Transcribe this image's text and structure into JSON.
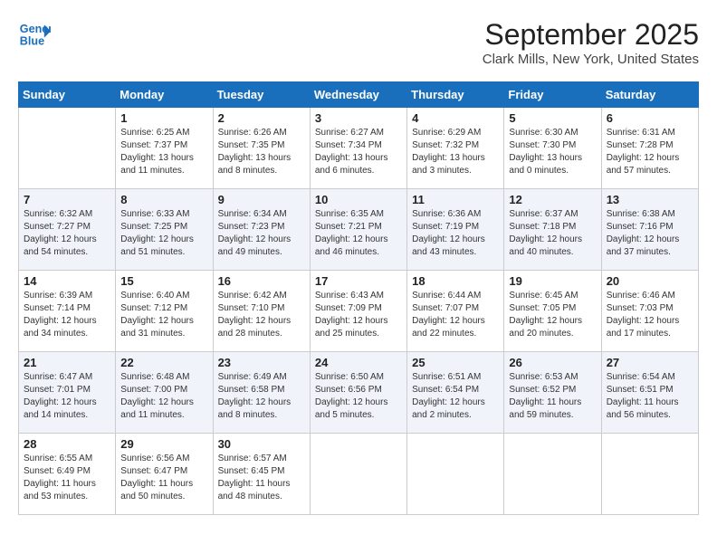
{
  "header": {
    "logo_line1": "General",
    "logo_line2": "Blue",
    "month": "September 2025",
    "location": "Clark Mills, New York, United States"
  },
  "weekdays": [
    "Sunday",
    "Monday",
    "Tuesday",
    "Wednesday",
    "Thursday",
    "Friday",
    "Saturday"
  ],
  "weeks": [
    [
      {
        "day": "",
        "info": ""
      },
      {
        "day": "1",
        "info": "Sunrise: 6:25 AM\nSunset: 7:37 PM\nDaylight: 13 hours\nand 11 minutes."
      },
      {
        "day": "2",
        "info": "Sunrise: 6:26 AM\nSunset: 7:35 PM\nDaylight: 13 hours\nand 8 minutes."
      },
      {
        "day": "3",
        "info": "Sunrise: 6:27 AM\nSunset: 7:34 PM\nDaylight: 13 hours\nand 6 minutes."
      },
      {
        "day": "4",
        "info": "Sunrise: 6:29 AM\nSunset: 7:32 PM\nDaylight: 13 hours\nand 3 minutes."
      },
      {
        "day": "5",
        "info": "Sunrise: 6:30 AM\nSunset: 7:30 PM\nDaylight: 13 hours\nand 0 minutes."
      },
      {
        "day": "6",
        "info": "Sunrise: 6:31 AM\nSunset: 7:28 PM\nDaylight: 12 hours\nand 57 minutes."
      }
    ],
    [
      {
        "day": "7",
        "info": "Sunrise: 6:32 AM\nSunset: 7:27 PM\nDaylight: 12 hours\nand 54 minutes."
      },
      {
        "day": "8",
        "info": "Sunrise: 6:33 AM\nSunset: 7:25 PM\nDaylight: 12 hours\nand 51 minutes."
      },
      {
        "day": "9",
        "info": "Sunrise: 6:34 AM\nSunset: 7:23 PM\nDaylight: 12 hours\nand 49 minutes."
      },
      {
        "day": "10",
        "info": "Sunrise: 6:35 AM\nSunset: 7:21 PM\nDaylight: 12 hours\nand 46 minutes."
      },
      {
        "day": "11",
        "info": "Sunrise: 6:36 AM\nSunset: 7:19 PM\nDaylight: 12 hours\nand 43 minutes."
      },
      {
        "day": "12",
        "info": "Sunrise: 6:37 AM\nSunset: 7:18 PM\nDaylight: 12 hours\nand 40 minutes."
      },
      {
        "day": "13",
        "info": "Sunrise: 6:38 AM\nSunset: 7:16 PM\nDaylight: 12 hours\nand 37 minutes."
      }
    ],
    [
      {
        "day": "14",
        "info": "Sunrise: 6:39 AM\nSunset: 7:14 PM\nDaylight: 12 hours\nand 34 minutes."
      },
      {
        "day": "15",
        "info": "Sunrise: 6:40 AM\nSunset: 7:12 PM\nDaylight: 12 hours\nand 31 minutes."
      },
      {
        "day": "16",
        "info": "Sunrise: 6:42 AM\nSunset: 7:10 PM\nDaylight: 12 hours\nand 28 minutes."
      },
      {
        "day": "17",
        "info": "Sunrise: 6:43 AM\nSunset: 7:09 PM\nDaylight: 12 hours\nand 25 minutes."
      },
      {
        "day": "18",
        "info": "Sunrise: 6:44 AM\nSunset: 7:07 PM\nDaylight: 12 hours\nand 22 minutes."
      },
      {
        "day": "19",
        "info": "Sunrise: 6:45 AM\nSunset: 7:05 PM\nDaylight: 12 hours\nand 20 minutes."
      },
      {
        "day": "20",
        "info": "Sunrise: 6:46 AM\nSunset: 7:03 PM\nDaylight: 12 hours\nand 17 minutes."
      }
    ],
    [
      {
        "day": "21",
        "info": "Sunrise: 6:47 AM\nSunset: 7:01 PM\nDaylight: 12 hours\nand 14 minutes."
      },
      {
        "day": "22",
        "info": "Sunrise: 6:48 AM\nSunset: 7:00 PM\nDaylight: 12 hours\nand 11 minutes."
      },
      {
        "day": "23",
        "info": "Sunrise: 6:49 AM\nSunset: 6:58 PM\nDaylight: 12 hours\nand 8 minutes."
      },
      {
        "day": "24",
        "info": "Sunrise: 6:50 AM\nSunset: 6:56 PM\nDaylight: 12 hours\nand 5 minutes."
      },
      {
        "day": "25",
        "info": "Sunrise: 6:51 AM\nSunset: 6:54 PM\nDaylight: 12 hours\nand 2 minutes."
      },
      {
        "day": "26",
        "info": "Sunrise: 6:53 AM\nSunset: 6:52 PM\nDaylight: 11 hours\nand 59 minutes."
      },
      {
        "day": "27",
        "info": "Sunrise: 6:54 AM\nSunset: 6:51 PM\nDaylight: 11 hours\nand 56 minutes."
      }
    ],
    [
      {
        "day": "28",
        "info": "Sunrise: 6:55 AM\nSunset: 6:49 PM\nDaylight: 11 hours\nand 53 minutes."
      },
      {
        "day": "29",
        "info": "Sunrise: 6:56 AM\nSunset: 6:47 PM\nDaylight: 11 hours\nand 50 minutes."
      },
      {
        "day": "30",
        "info": "Sunrise: 6:57 AM\nSunset: 6:45 PM\nDaylight: 11 hours\nand 48 minutes."
      },
      {
        "day": "",
        "info": ""
      },
      {
        "day": "",
        "info": ""
      },
      {
        "day": "",
        "info": ""
      },
      {
        "day": "",
        "info": ""
      }
    ]
  ]
}
